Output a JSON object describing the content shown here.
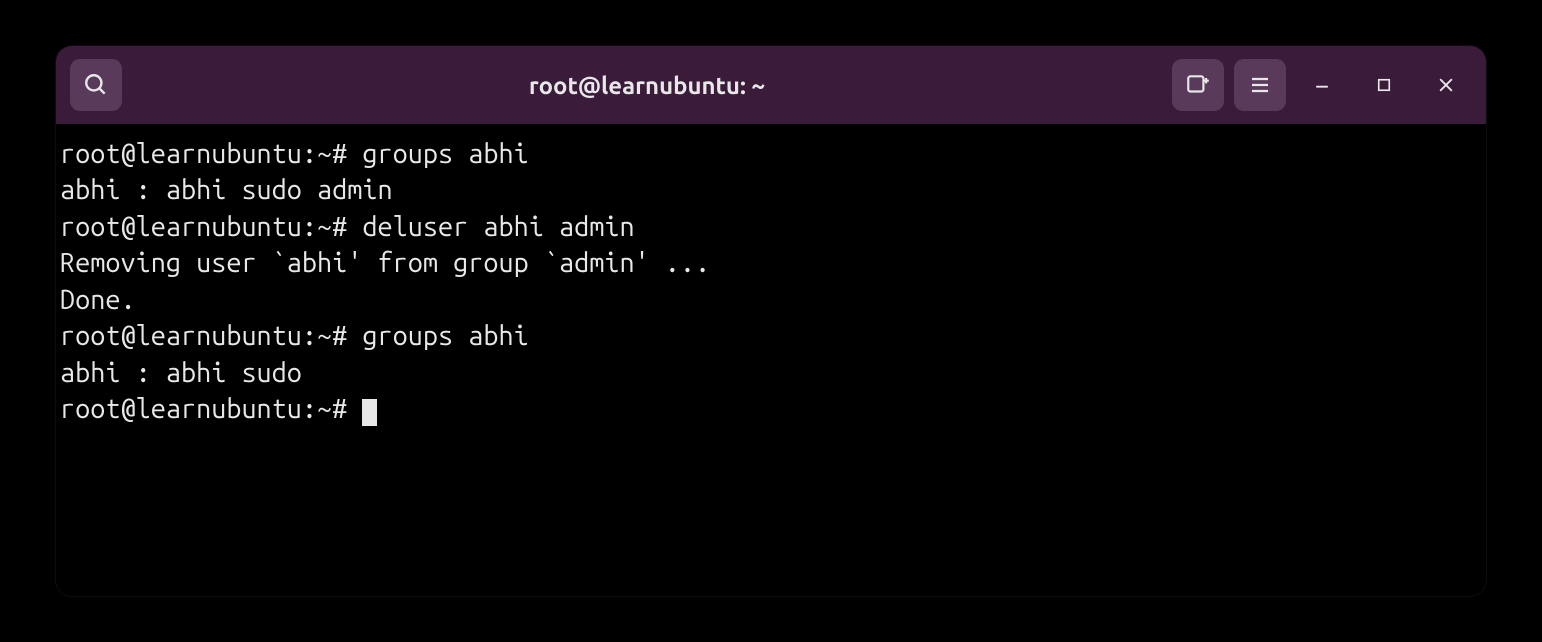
{
  "window": {
    "title": "root@learnubuntu: ~"
  },
  "terminal": {
    "lines": [
      "root@learnubuntu:~# groups abhi",
      "abhi : abhi sudo admin",
      "root@learnubuntu:~# deluser abhi admin",
      "Removing user `abhi' from group `admin' ...",
      "Done.",
      "root@learnubuntu:~# groups abhi",
      "abhi : abhi sudo",
      "root@learnubuntu:~# "
    ]
  },
  "icons": {
    "search": "search-icon",
    "new_tab": "new-tab-icon",
    "menu": "hamburger-menu-icon",
    "minimize": "minimize-icon",
    "maximize": "maximize-icon",
    "close": "close-icon"
  }
}
